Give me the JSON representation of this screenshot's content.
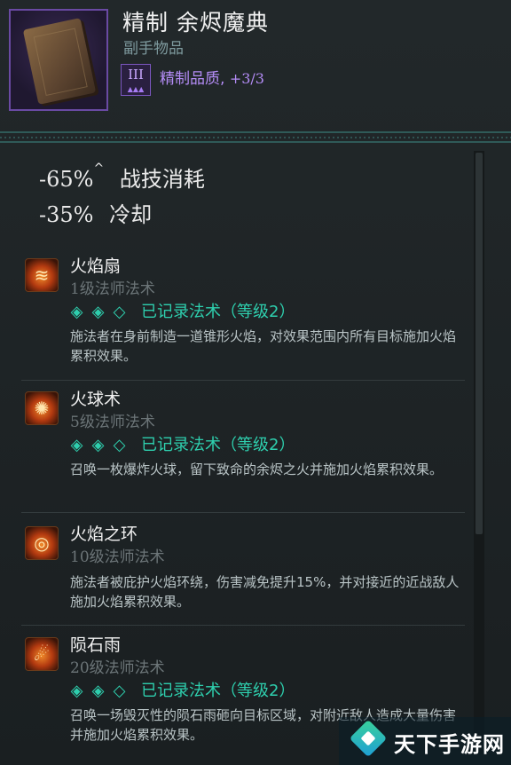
{
  "item": {
    "title": "精制 余烬魔典",
    "subtitle": "副手物品",
    "tier_numeral": "III",
    "tier_stars": "▲▲▲",
    "quality_label": "精制品质,",
    "quality_value": "+3/3",
    "icon": "book-icon"
  },
  "stats": [
    {
      "value": "-65%",
      "mark": "^",
      "label": "战技消耗"
    },
    {
      "value": "-35%",
      "mark": "",
      "label": "冷却"
    }
  ],
  "spells": [
    {
      "name": "火焰扇",
      "level_num": "1",
      "level_text": "级法师法术",
      "gems": [
        "◈",
        "◈",
        "◇"
      ],
      "record": "已记录法术（等级2）",
      "desc": "施法者在身前制造一道锥形火焰，对效果范围内所有目标施加火焰累积效果。",
      "icon": "flame-fan-icon",
      "glyph": "≋"
    },
    {
      "name": "火球术",
      "level_num": "5",
      "level_text": "级法师法术",
      "gems": [
        "◈",
        "◈",
        "◇"
      ],
      "record": "已记录法术（等级2）",
      "desc": "召唤一枚爆炸火球，留下致命的余烬之火并施加火焰累积效果。",
      "icon": "fireball-icon",
      "glyph": "✺"
    },
    {
      "name": "火焰之环",
      "level_num": "10",
      "level_text": "级法师法术",
      "gems": [],
      "record": "",
      "desc": "施法者被庇护火焰环绕，伤害减免提升15%，并对接近的近战敌人施加火焰累积效果。",
      "icon": "ring-of-fire-icon",
      "glyph": "◎"
    },
    {
      "name": "陨石雨",
      "level_num": "20",
      "level_text": "级法师法术",
      "gems": [
        "◈",
        "◈",
        "◇"
      ],
      "record": "已记录法术（等级2）",
      "desc": "召唤一场毁灭性的陨石雨砸向目标区域，对附近敌人造成大量伤害并施加火焰累积效果。",
      "icon": "meteor-icon",
      "glyph": "☄"
    }
  ],
  "watermark": {
    "text": "天下手游网",
    "icon": "site-logo-icon"
  }
}
